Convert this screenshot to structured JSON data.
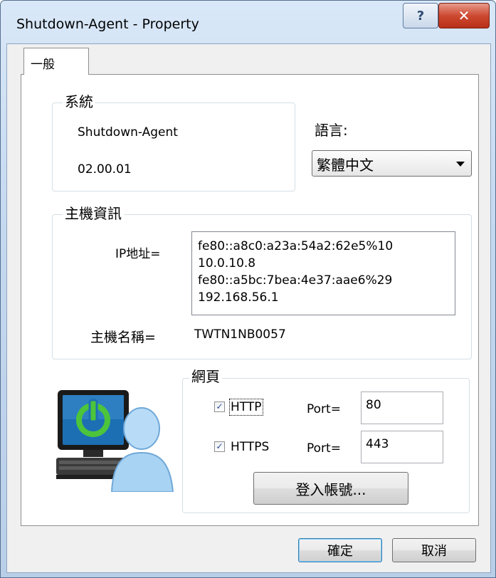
{
  "window": {
    "title": "Shutdown-Agent - Property",
    "help_glyph": "?",
    "close_glyph": "✕"
  },
  "tabs": [
    {
      "label": "一般",
      "selected": true
    }
  ],
  "system_group": {
    "legend": "系統",
    "product_name": "Shutdown-Agent",
    "version": "02.00.01"
  },
  "language": {
    "label": "語言:",
    "selected": "繁體中文"
  },
  "host_group": {
    "legend": "主機資訊",
    "ip_label": "IP地址=",
    "ip_addresses": [
      "fe80::a8c0:a23a:54a2:62e5%10",
      "10.0.10.8",
      "fe80::a5bc:7bea:4e37:aae6%29",
      "192.168.56.1"
    ],
    "hostname_label": "主機名稱=",
    "hostname": "TWTN1NB0057"
  },
  "web_group": {
    "legend": "網頁",
    "http": {
      "label": "HTTP",
      "checked": true,
      "port_label": "Port=",
      "port": "80"
    },
    "https": {
      "label": "HTTPS",
      "checked": true,
      "port_label": "Port=",
      "port": "443"
    },
    "login_button": "登入帳號..."
  },
  "footer": {
    "ok_label": "確定",
    "cancel_label": "取消"
  },
  "icons": {
    "app_icon": "computer-power-user-icon",
    "check_glyph": "✓"
  },
  "colors": {
    "power_green": "#4cc43b",
    "screen_blue": "#1d6fb4",
    "close_red": "#c8412a"
  }
}
